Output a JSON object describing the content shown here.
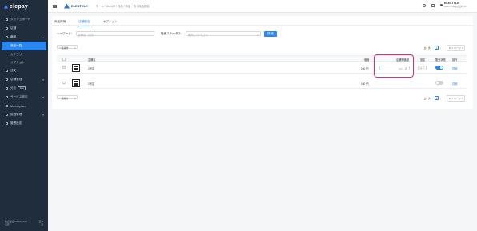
{
  "sidebar": {
    "logo": "elepay",
    "items": [
      {
        "label": "ダッシュボード"
      },
      {
        "label": "店舗"
      },
      {
        "label": "商品"
      },
      {
        "label": "商品一覧"
      },
      {
        "label": "カテゴリー"
      },
      {
        "label": "オプション"
      },
      {
        "label": "注文"
      },
      {
        "label": "店舗管理"
      },
      {
        "label": "分析",
        "badge": "beta"
      },
      {
        "label": "サービス設定"
      },
      {
        "label": "Marketplace"
      },
      {
        "label": "権限管理"
      },
      {
        "label": "管理設定"
      }
    ],
    "footer_id": "株式会社XXXXXXXXX",
    "footer_sub": "設定",
    "footer_lang": "日本",
    "footer_lang2": "語"
  },
  "header": {
    "brand": "ELESTYLE",
    "breadcrumb": "ホーム / OneQR / 商品 / 商品一覧 / 商品詳細",
    "user_name": "ELESTYLE",
    "user_sub": "ELESTYLE株式会社 ID..."
  },
  "tabs": [
    {
      "label": "商品情報"
    },
    {
      "label": "店舗設定"
    },
    {
      "label": "オプション"
    }
  ],
  "filters": {
    "keyword_label": "キーワード：",
    "keyword_placeholder": "店舗名、住所",
    "status_label": "販売ステータス：",
    "status_placeholder": "選択してください",
    "search_button": "検 索"
  },
  "bulk_action": "一括操作",
  "pagination": {
    "total": "全2 件",
    "page": "1",
    "per_page": "10 / ページ"
  },
  "table": {
    "headers": {
      "store": "店舗名",
      "price": "価格",
      "store_price": "店舗別価格",
      "set": "設定",
      "sale_status": "販売状態",
      "action": "操作"
    },
    "rows": [
      {
        "store": "2号店",
        "price": "100 円",
        "store_price": "100",
        "currency": "円",
        "set": "設定",
        "on": true,
        "action": "詳細"
      },
      {
        "store": "2号店",
        "price": "100 円",
        "store_price": "",
        "currency": "",
        "set": "",
        "on": false,
        "action": "詳細"
      }
    ]
  },
  "colors": {
    "accent": "#2b87f0",
    "sidebar_bg": "#1f2d3d",
    "highlight": "#e8297a"
  }
}
